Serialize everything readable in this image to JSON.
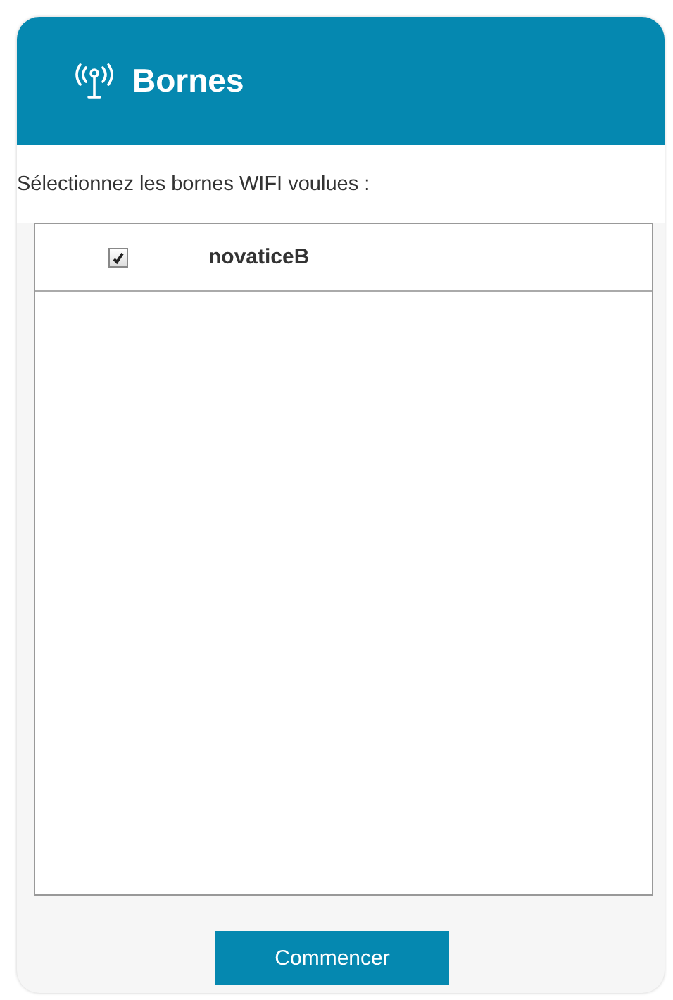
{
  "header": {
    "title": "Bornes"
  },
  "instruction": "Sélectionnez les bornes WIFI voulues :",
  "access_points": [
    {
      "name": "novaticeB",
      "checked": true
    }
  ],
  "buttons": [
    "Commencer"
  ]
}
